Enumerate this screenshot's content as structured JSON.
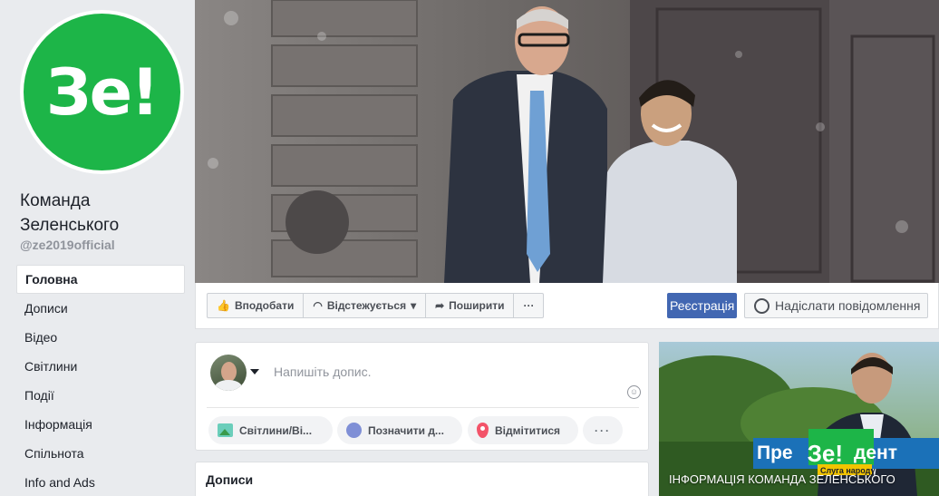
{
  "page": {
    "name": "Команда Зеленського",
    "handle": "@ze2019official",
    "logo_text": "Зе!",
    "brand_color": "#1db548"
  },
  "sidebar": {
    "items": [
      {
        "label": "Головна",
        "active": true
      },
      {
        "label": "Дописи"
      },
      {
        "label": "Відео"
      },
      {
        "label": "Світлини"
      },
      {
        "label": "Події"
      },
      {
        "label": "Інформація"
      },
      {
        "label": "Спільнота"
      },
      {
        "label": "Info and Ads"
      }
    ]
  },
  "actions": {
    "like": "Вподобати",
    "follow": "Відстежується",
    "share": "Поширити",
    "more": "···",
    "register": "Реєстрація",
    "message": "Надіслати повідомлення",
    "register_color": "#4267b2"
  },
  "composer": {
    "placeholder": "Напишіть допис.",
    "photo": "Світлини/Ві...",
    "tag": "Позначити д...",
    "checkin": "Відмітитися",
    "more": "···"
  },
  "posts": {
    "title": "Дописи"
  },
  "promo": {
    "caption": "ІНФОРМАЦІЯ КОМАНДА ЗЕЛЕНСЬКОГО",
    "logo_left": "Пре",
    "logo_mid": "Зе!",
    "logo_right": "дент",
    "logo_sub": "Слуга народу"
  }
}
